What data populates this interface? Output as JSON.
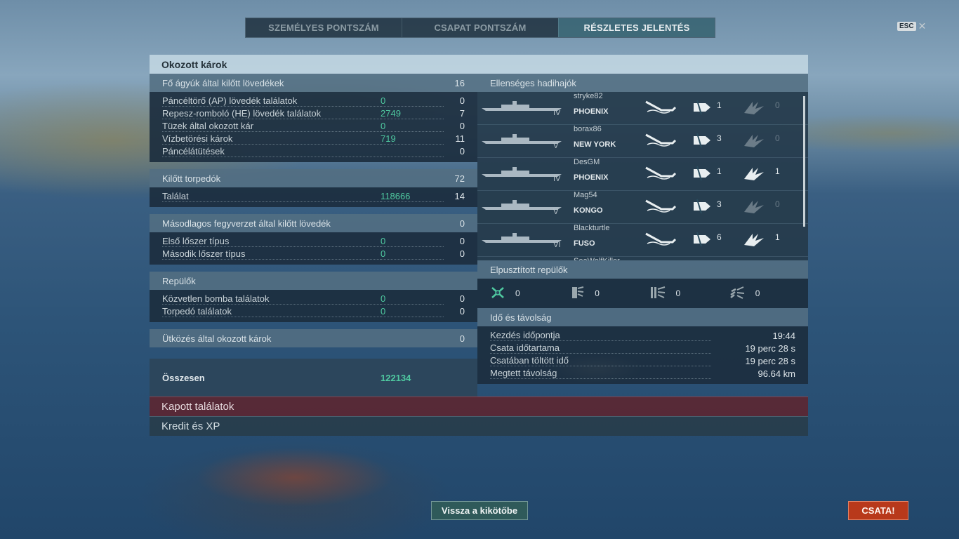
{
  "tabs": [
    "SZEMÉLYES PONTSZÁM",
    "CSAPAT PONTSZÁM",
    "RÉSZLETES JELENTÉS"
  ],
  "esc_label": "ESC",
  "panel_title": "Okozott károk",
  "main_guns": {
    "label": "Fő ágyúk által kilőtt lövedékek",
    "count": "16",
    "rows": [
      {
        "label": "Páncéltörő (AP) lövedék találatok",
        "damage": "0",
        "count": "0"
      },
      {
        "label": "Repesz-romboló (HE) lövedék találatok",
        "damage": "2749",
        "count": "7"
      },
      {
        "label": "Tüzek által okozott kár",
        "damage": "0",
        "count": "0"
      },
      {
        "label": "Vízbetörési károk",
        "damage": "719",
        "count": "11"
      },
      {
        "label": "Páncélátütések",
        "damage": "",
        "count": "0"
      }
    ]
  },
  "torpedoes": {
    "label": "Kilőtt torpedók",
    "count": "72",
    "rows": [
      {
        "label": "Találat",
        "damage": "118666",
        "count": "14"
      }
    ]
  },
  "secondary": {
    "label": "Másodlagos fegyverzet által kilőtt lövedék",
    "count": "0",
    "rows": [
      {
        "label": "Első lőszer típus",
        "damage": "0",
        "count": "0"
      },
      {
        "label": "Második lőszer típus",
        "damage": "0",
        "count": "0"
      }
    ]
  },
  "aircraft": {
    "label": "Repülők",
    "rows": [
      {
        "label": "Közvetlen bomba találatok",
        "damage": "0",
        "count": "0"
      },
      {
        "label": "Torpedó találatok",
        "damage": "0",
        "count": "0"
      }
    ]
  },
  "ramming": {
    "label": "Ütközés által okozott károk",
    "count": "0"
  },
  "total": {
    "label": "Összesen",
    "damage": "122134"
  },
  "enemy_ships": {
    "label": "Ellenséges hadihajók",
    "ships": [
      {
        "player": "stryke82",
        "tier": "IV",
        "name": "PHOENIX",
        "hits": "1",
        "crits": "0"
      },
      {
        "player": "borax86",
        "tier": "V",
        "name": "NEW YORK",
        "hits": "3",
        "crits": "0"
      },
      {
        "player": "DesGM",
        "tier": "IV",
        "name": "PHOENIX",
        "hits": "1",
        "crits": "1"
      },
      {
        "player": "Mag54",
        "tier": "V",
        "name": "KONGO",
        "hits": "3",
        "crits": "0"
      },
      {
        "player": "Blackturtle",
        "tier": "VI",
        "name": "FUSO",
        "hits": "6",
        "crits": "1"
      },
      {
        "player": "SeaWolfKiller",
        "tier": "",
        "name": "",
        "hits": "",
        "crits": ""
      }
    ]
  },
  "planes_destroyed": {
    "label": "Elpusztított repülők",
    "items": [
      {
        "icon": "fighter-icon",
        "value": "0"
      },
      {
        "icon": "torpedo-bomber-icon",
        "value": "0"
      },
      {
        "icon": "dive-bomber-icon",
        "value": "0"
      },
      {
        "icon": "spotter-icon",
        "value": "0"
      }
    ]
  },
  "time_distance": {
    "label": "Idő és távolság",
    "rows": [
      {
        "label": "Kezdés időpontja",
        "value": "19:44"
      },
      {
        "label": "Csata időtartama",
        "value": "19 perc 28 s"
      },
      {
        "label": "Csatában töltött idő",
        "value": "19 perc 28 s"
      },
      {
        "label": "Megtett távolság",
        "value": "96.64 km"
      }
    ]
  },
  "received_hits": "Kapott találatok",
  "credits_xp": "Kredit és XP",
  "back_button": "Vissza a kikötőbe",
  "battle_button": "CSATA!"
}
